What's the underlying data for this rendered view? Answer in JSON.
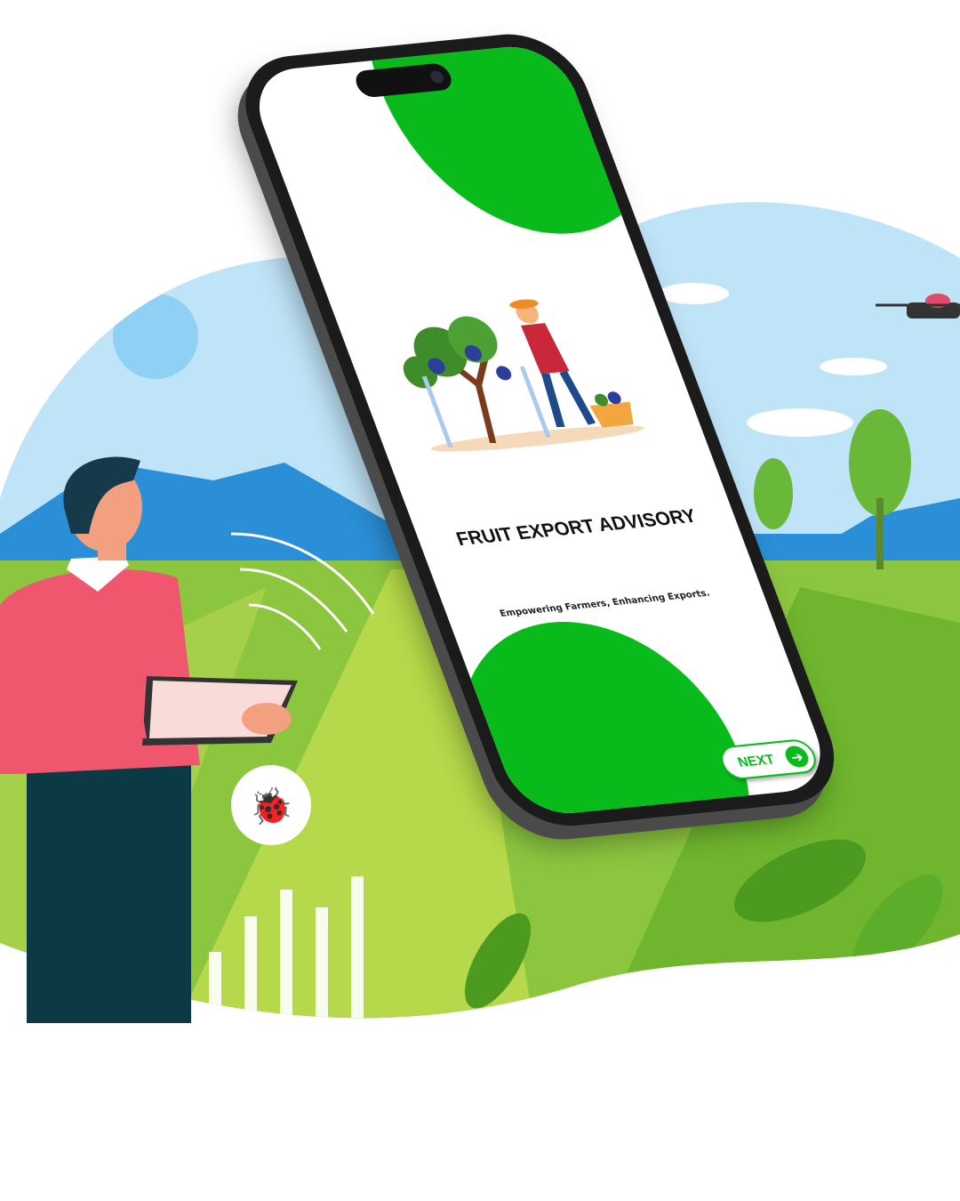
{
  "app": {
    "title": "FRUIT EXPORT ADVISORY",
    "tagline": "Empowering Farmers, Enhancing Exports.",
    "next_label": "NEXT",
    "icons": {
      "next": "arrow-right-circle-icon"
    }
  },
  "colors": {
    "accent": "#08bb1b",
    "sky": "#bfe3f7",
    "mountain": "#2a8fd6",
    "field": "#8cc63f"
  }
}
